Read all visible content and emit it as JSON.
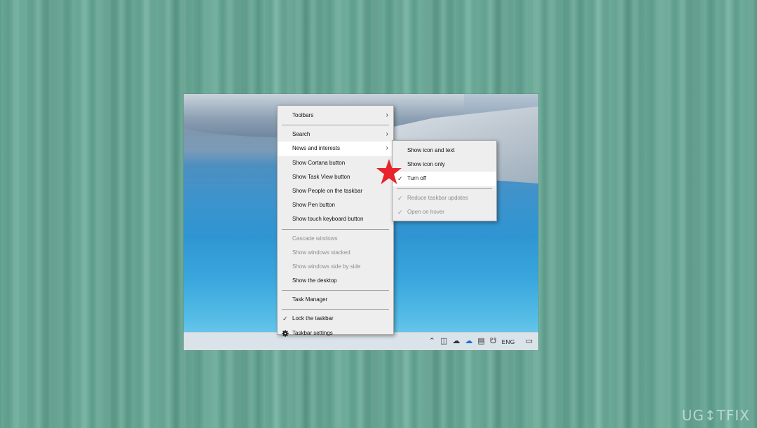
{
  "main_menu": {
    "items": [
      {
        "label": "Toolbars",
        "submenu": true
      },
      {
        "label": "Search",
        "submenu": true
      },
      {
        "label": "News and interests",
        "submenu": true
      },
      {
        "label": "Show Cortana button"
      },
      {
        "label": "Show Task View button"
      },
      {
        "label": "Show People on the taskbar"
      },
      {
        "label": "Show Pen button"
      },
      {
        "label": "Show touch keyboard button"
      },
      {
        "label": "Cascade windows",
        "disabled": true
      },
      {
        "label": "Show windows stacked",
        "disabled": true
      },
      {
        "label": "Show windows side by side",
        "disabled": true
      },
      {
        "label": "Show the desktop"
      },
      {
        "label": "Task Manager"
      },
      {
        "label": "Lock the taskbar",
        "checked": true
      },
      {
        "label": "Taskbar settings",
        "icon": "gear-icon"
      }
    ]
  },
  "sub_menu": {
    "items": [
      {
        "label": "Show icon and text"
      },
      {
        "label": "Show icon only"
      },
      {
        "label": "Turn off",
        "checked": true
      },
      {
        "label": "Reduce taskbar updates",
        "checked": true,
        "disabled": true
      },
      {
        "label": "Open on hover",
        "checked": true,
        "disabled": true
      }
    ]
  },
  "taskbar": {
    "language": "ENG",
    "tray_icons": [
      "chevron-up-icon",
      "usb-icon",
      "cloud-outline-icon",
      "onedrive-icon",
      "network-icon",
      "volume-icon"
    ],
    "notification_icon": "action-center-icon"
  },
  "annotation": {
    "star_color": "#e8232a"
  },
  "watermark": {
    "text": "UG↕TFIX"
  },
  "colors": {
    "menu_bg": "#eeeeee",
    "hover_bg": "#ffffff",
    "disabled_text": "#8d8d8d",
    "desktop_bg": "#6aa896"
  }
}
